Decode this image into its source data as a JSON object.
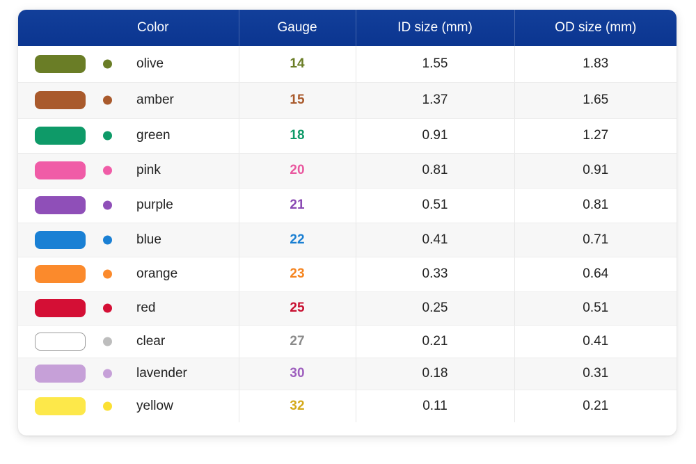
{
  "headers": {
    "color": "Color",
    "gauge": "Gauge",
    "id_size": "ID size (mm)",
    "od_size": "OD size (mm)"
  },
  "rows": [
    {
      "color_name": "olive",
      "gauge": "14",
      "id_mm": "1.55",
      "od_mm": "1.83",
      "swatch": "#6a7d26",
      "gauge_color": "#6a7d26"
    },
    {
      "color_name": "amber",
      "gauge": "15",
      "id_mm": "1.37",
      "od_mm": "1.65",
      "swatch": "#a95a2c",
      "gauge_color": "#a95a2c"
    },
    {
      "color_name": "green",
      "gauge": "18",
      "id_mm": "0.91",
      "od_mm": "1.27",
      "swatch": "#0e9a68",
      "gauge_color": "#0e9a68"
    },
    {
      "color_name": "pink",
      "gauge": "20",
      "id_mm": "0.81",
      "od_mm": "0.91",
      "swatch": "#f05ca7",
      "gauge_color": "#e9589f"
    },
    {
      "color_name": "purple",
      "gauge": "21",
      "id_mm": "0.51",
      "od_mm": "0.81",
      "swatch": "#8f4fb8",
      "gauge_color": "#8a49b3"
    },
    {
      "color_name": "blue",
      "gauge": "22",
      "id_mm": "0.41",
      "od_mm": "0.71",
      "swatch": "#1a80d4",
      "gauge_color": "#1a7fd2"
    },
    {
      "color_name": "orange",
      "gauge": "23",
      "id_mm": "0.33",
      "od_mm": "0.64",
      "swatch": "#fb8a2c",
      "gauge_color": "#f5841f"
    },
    {
      "color_name": "red",
      "gauge": "25",
      "id_mm": "0.25",
      "od_mm": "0.51",
      "swatch": "#d40f35",
      "gauge_color": "#c80f30"
    },
    {
      "color_name": "clear",
      "gauge": "27",
      "id_mm": "0.21",
      "od_mm": "0.41",
      "swatch": "#ffffff",
      "gauge_color": "#8a8a8a",
      "dot": "#bdbdbd",
      "outline": "#9a9a9a"
    },
    {
      "color_name": "lavender",
      "gauge": "30",
      "id_mm": "0.18",
      "od_mm": "0.31",
      "swatch": "#c6a0d8",
      "gauge_color": "#9e5fbe"
    },
    {
      "color_name": "yellow",
      "gauge": "32",
      "id_mm": "0.11",
      "od_mm": "0.21",
      "swatch": "#fde84a",
      "gauge_color": "#d4a91a",
      "dot": "#fbe033"
    }
  ]
}
